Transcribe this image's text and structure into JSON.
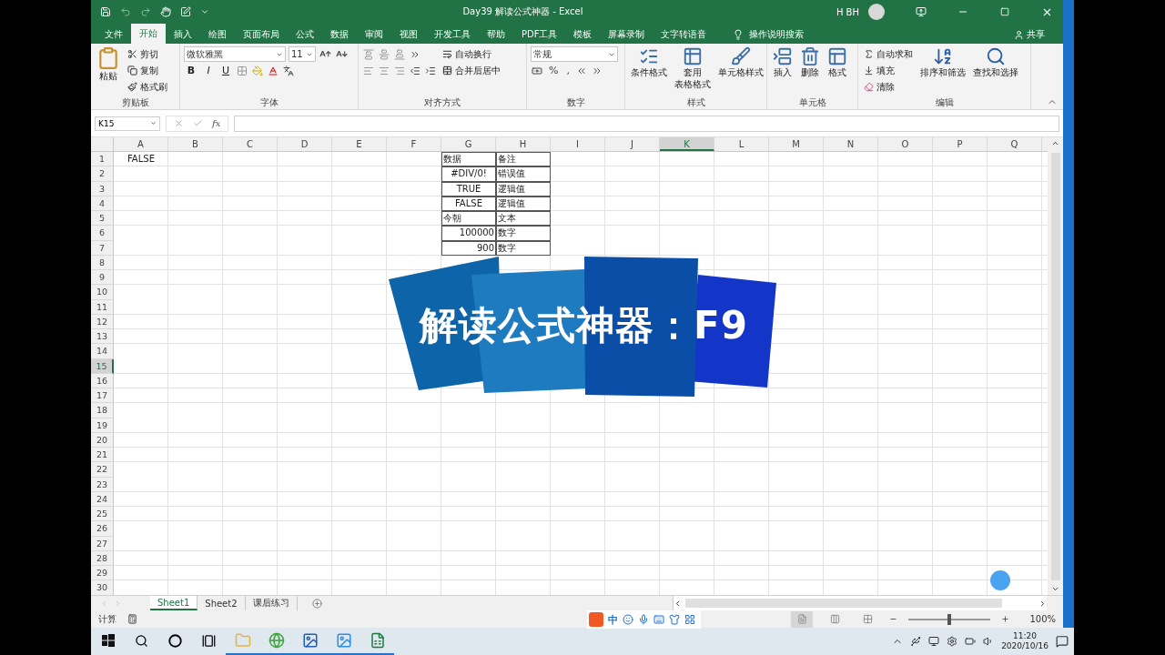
{
  "title_bar": {
    "title": "Day39 解读公式神器 - Excel",
    "user": "H BH"
  },
  "menu_tabs": [
    {
      "label": "文件",
      "selected": false
    },
    {
      "label": "开始",
      "selected": true
    },
    {
      "label": "插入",
      "selected": false
    },
    {
      "label": "绘图",
      "selected": false
    },
    {
      "label": "页面布局",
      "selected": false
    },
    {
      "label": "公式",
      "selected": false
    },
    {
      "label": "数据",
      "selected": false
    },
    {
      "label": "审阅",
      "selected": false
    },
    {
      "label": "视图",
      "selected": false
    },
    {
      "label": "开发工具",
      "selected": false
    },
    {
      "label": "帮助",
      "selected": false
    },
    {
      "label": "PDF工具",
      "selected": false
    },
    {
      "label": "模板",
      "selected": false
    },
    {
      "label": "屏幕录制",
      "selected": false
    },
    {
      "label": "文字转语音",
      "selected": false
    }
  ],
  "tell_me": "操作说明搜索",
  "share": "共享",
  "ribbon": {
    "groups": [
      {
        "kind": "clipboard",
        "label": "剪贴板",
        "big": "粘贴",
        "items": [
          "剪切",
          "复制",
          "格式刷"
        ]
      },
      {
        "kind": "font",
        "label": "字体",
        "font_name": "微软雅黑",
        "font_size": "11",
        "styles": [
          "B",
          "I",
          "U"
        ]
      },
      {
        "kind": "alignment",
        "label": "对齐方式",
        "items": [
          "自动换行",
          "合并后居中"
        ]
      },
      {
        "kind": "number",
        "label": "数字",
        "format": "常规",
        "symbols": [
          "%",
          ","
        ]
      },
      {
        "kind": "styles",
        "label": "样式",
        "items": [
          {
            "lines": [
              "条件格式"
            ]
          },
          {
            "lines": [
              "套用",
              "表格格式"
            ]
          },
          {
            "lines": [
              "单元格样式"
            ]
          }
        ]
      },
      {
        "kind": "cells",
        "label": "单元格",
        "items": [
          {
            "lines": [
              "插入"
            ]
          },
          {
            "lines": [
              "删除"
            ]
          },
          {
            "lines": [
              "格式"
            ]
          }
        ]
      },
      {
        "kind": "editing",
        "label": "编辑",
        "items": [
          "自动求和",
          "填充",
          "清除"
        ],
        "big": [
          "排序和筛选",
          "查找和选择"
        ]
      }
    ]
  },
  "formula_bar": {
    "name_box": "K15",
    "fx": "fx"
  },
  "columns": [
    {
      "label": "A",
      "selected": false
    },
    {
      "label": "B",
      "selected": false
    },
    {
      "label": "C",
      "selected": false
    },
    {
      "label": "D",
      "selected": false
    },
    {
      "label": "E",
      "selected": false
    },
    {
      "label": "F",
      "selected": false
    },
    {
      "label": "G",
      "selected": false
    },
    {
      "label": "H",
      "selected": false
    },
    {
      "label": "I",
      "selected": false
    },
    {
      "label": "J",
      "selected": false
    },
    {
      "label": "K",
      "selected": true
    },
    {
      "label": "L",
      "selected": false
    },
    {
      "label": "M",
      "selected": false
    },
    {
      "label": "N",
      "selected": false
    },
    {
      "label": "O",
      "selected": false
    },
    {
      "label": "P",
      "selected": false
    },
    {
      "label": "Q",
      "selected": false
    }
  ],
  "rows": [
    {
      "label": "1",
      "selected": false,
      "cells": [
        {
          "text": "FALSE",
          "kind": "logical"
        },
        {},
        {},
        {},
        {},
        {},
        {
          "text": "数据",
          "kind": "text",
          "border": true
        },
        {
          "text": "备注",
          "kind": "text",
          "border": true
        }
      ]
    },
    {
      "label": "2",
      "selected": false,
      "cells": [
        {},
        {},
        {},
        {},
        {},
        {},
        {
          "text": "#DIV/0!",
          "kind": "error",
          "border": true
        },
        {
          "text": "错误值",
          "kind": "text",
          "border": true
        }
      ]
    },
    {
      "label": "3",
      "selected": false,
      "cells": [
        {},
        {},
        {},
        {},
        {},
        {},
        {
          "text": "TRUE",
          "kind": "logical",
          "border": true
        },
        {
          "text": "逻辑值",
          "kind": "text",
          "border": true
        }
      ]
    },
    {
      "label": "4",
      "selected": false,
      "cells": [
        {},
        {},
        {},
        {},
        {},
        {},
        {
          "text": "FALSE",
          "kind": "logical",
          "border": true
        },
        {
          "text": "逻辑值",
          "kind": "text",
          "border": true
        }
      ]
    },
    {
      "label": "5",
      "selected": false,
      "cells": [
        {},
        {},
        {},
        {},
        {},
        {},
        {
          "text": "今朝",
          "kind": "text",
          "border": true
        },
        {
          "text": "文本",
          "kind": "text",
          "border": true
        }
      ]
    },
    {
      "label": "6",
      "selected": false,
      "cells": [
        {},
        {},
        {},
        {},
        {},
        {},
        {
          "text": "100000",
          "kind": "number",
          "border": true
        },
        {
          "text": "数字",
          "kind": "text",
          "border": true
        }
      ]
    },
    {
      "label": "7",
      "selected": false,
      "cells": [
        {},
        {},
        {},
        {},
        {},
        {},
        {
          "text": "900",
          "kind": "number",
          "border": true
        },
        {
          "text": "数字",
          "kind": "text",
          "border": true
        }
      ]
    },
    {
      "label": "8",
      "selected": false
    },
    {
      "label": "9",
      "selected": false
    },
    {
      "label": "10",
      "selected": false
    },
    {
      "label": "11",
      "selected": false
    },
    {
      "label": "12",
      "selected": false
    },
    {
      "label": "13",
      "selected": false
    },
    {
      "label": "14",
      "selected": false
    },
    {
      "label": "15",
      "selected": true
    },
    {
      "label": "16",
      "selected": false
    },
    {
      "label": "17",
      "selected": false
    },
    {
      "label": "18",
      "selected": false
    },
    {
      "label": "19",
      "selected": false
    },
    {
      "label": "20",
      "selected": false
    },
    {
      "label": "21",
      "selected": false
    },
    {
      "label": "22",
      "selected": false
    },
    {
      "label": "23",
      "selected": false
    },
    {
      "label": "24",
      "selected": false
    },
    {
      "label": "25",
      "selected": false
    },
    {
      "label": "26",
      "selected": false
    },
    {
      "label": "27",
      "selected": false
    },
    {
      "label": "28",
      "selected": false
    },
    {
      "label": "29",
      "selected": false
    },
    {
      "label": "30",
      "selected": false
    }
  ],
  "banner": {
    "title": "解读公式神器：F9"
  },
  "sheets": [
    {
      "label": "Sheet1",
      "selected": true
    },
    {
      "label": "Sheet2",
      "selected": false
    },
    {
      "label": "课后练习",
      "selected": false
    }
  ],
  "status_bar": {
    "mode": "计算",
    "ime": "中",
    "zoom": "100%",
    "zoom_level": {
      "level": 0.5
    }
  },
  "taskbar": {
    "apps": [
      {
        "running": true
      },
      {
        "running": true
      },
      {
        "running": true
      },
      {
        "running": true
      },
      {
        "running": true
      }
    ],
    "time": "11:20",
    "date": "2020/10/16"
  }
}
